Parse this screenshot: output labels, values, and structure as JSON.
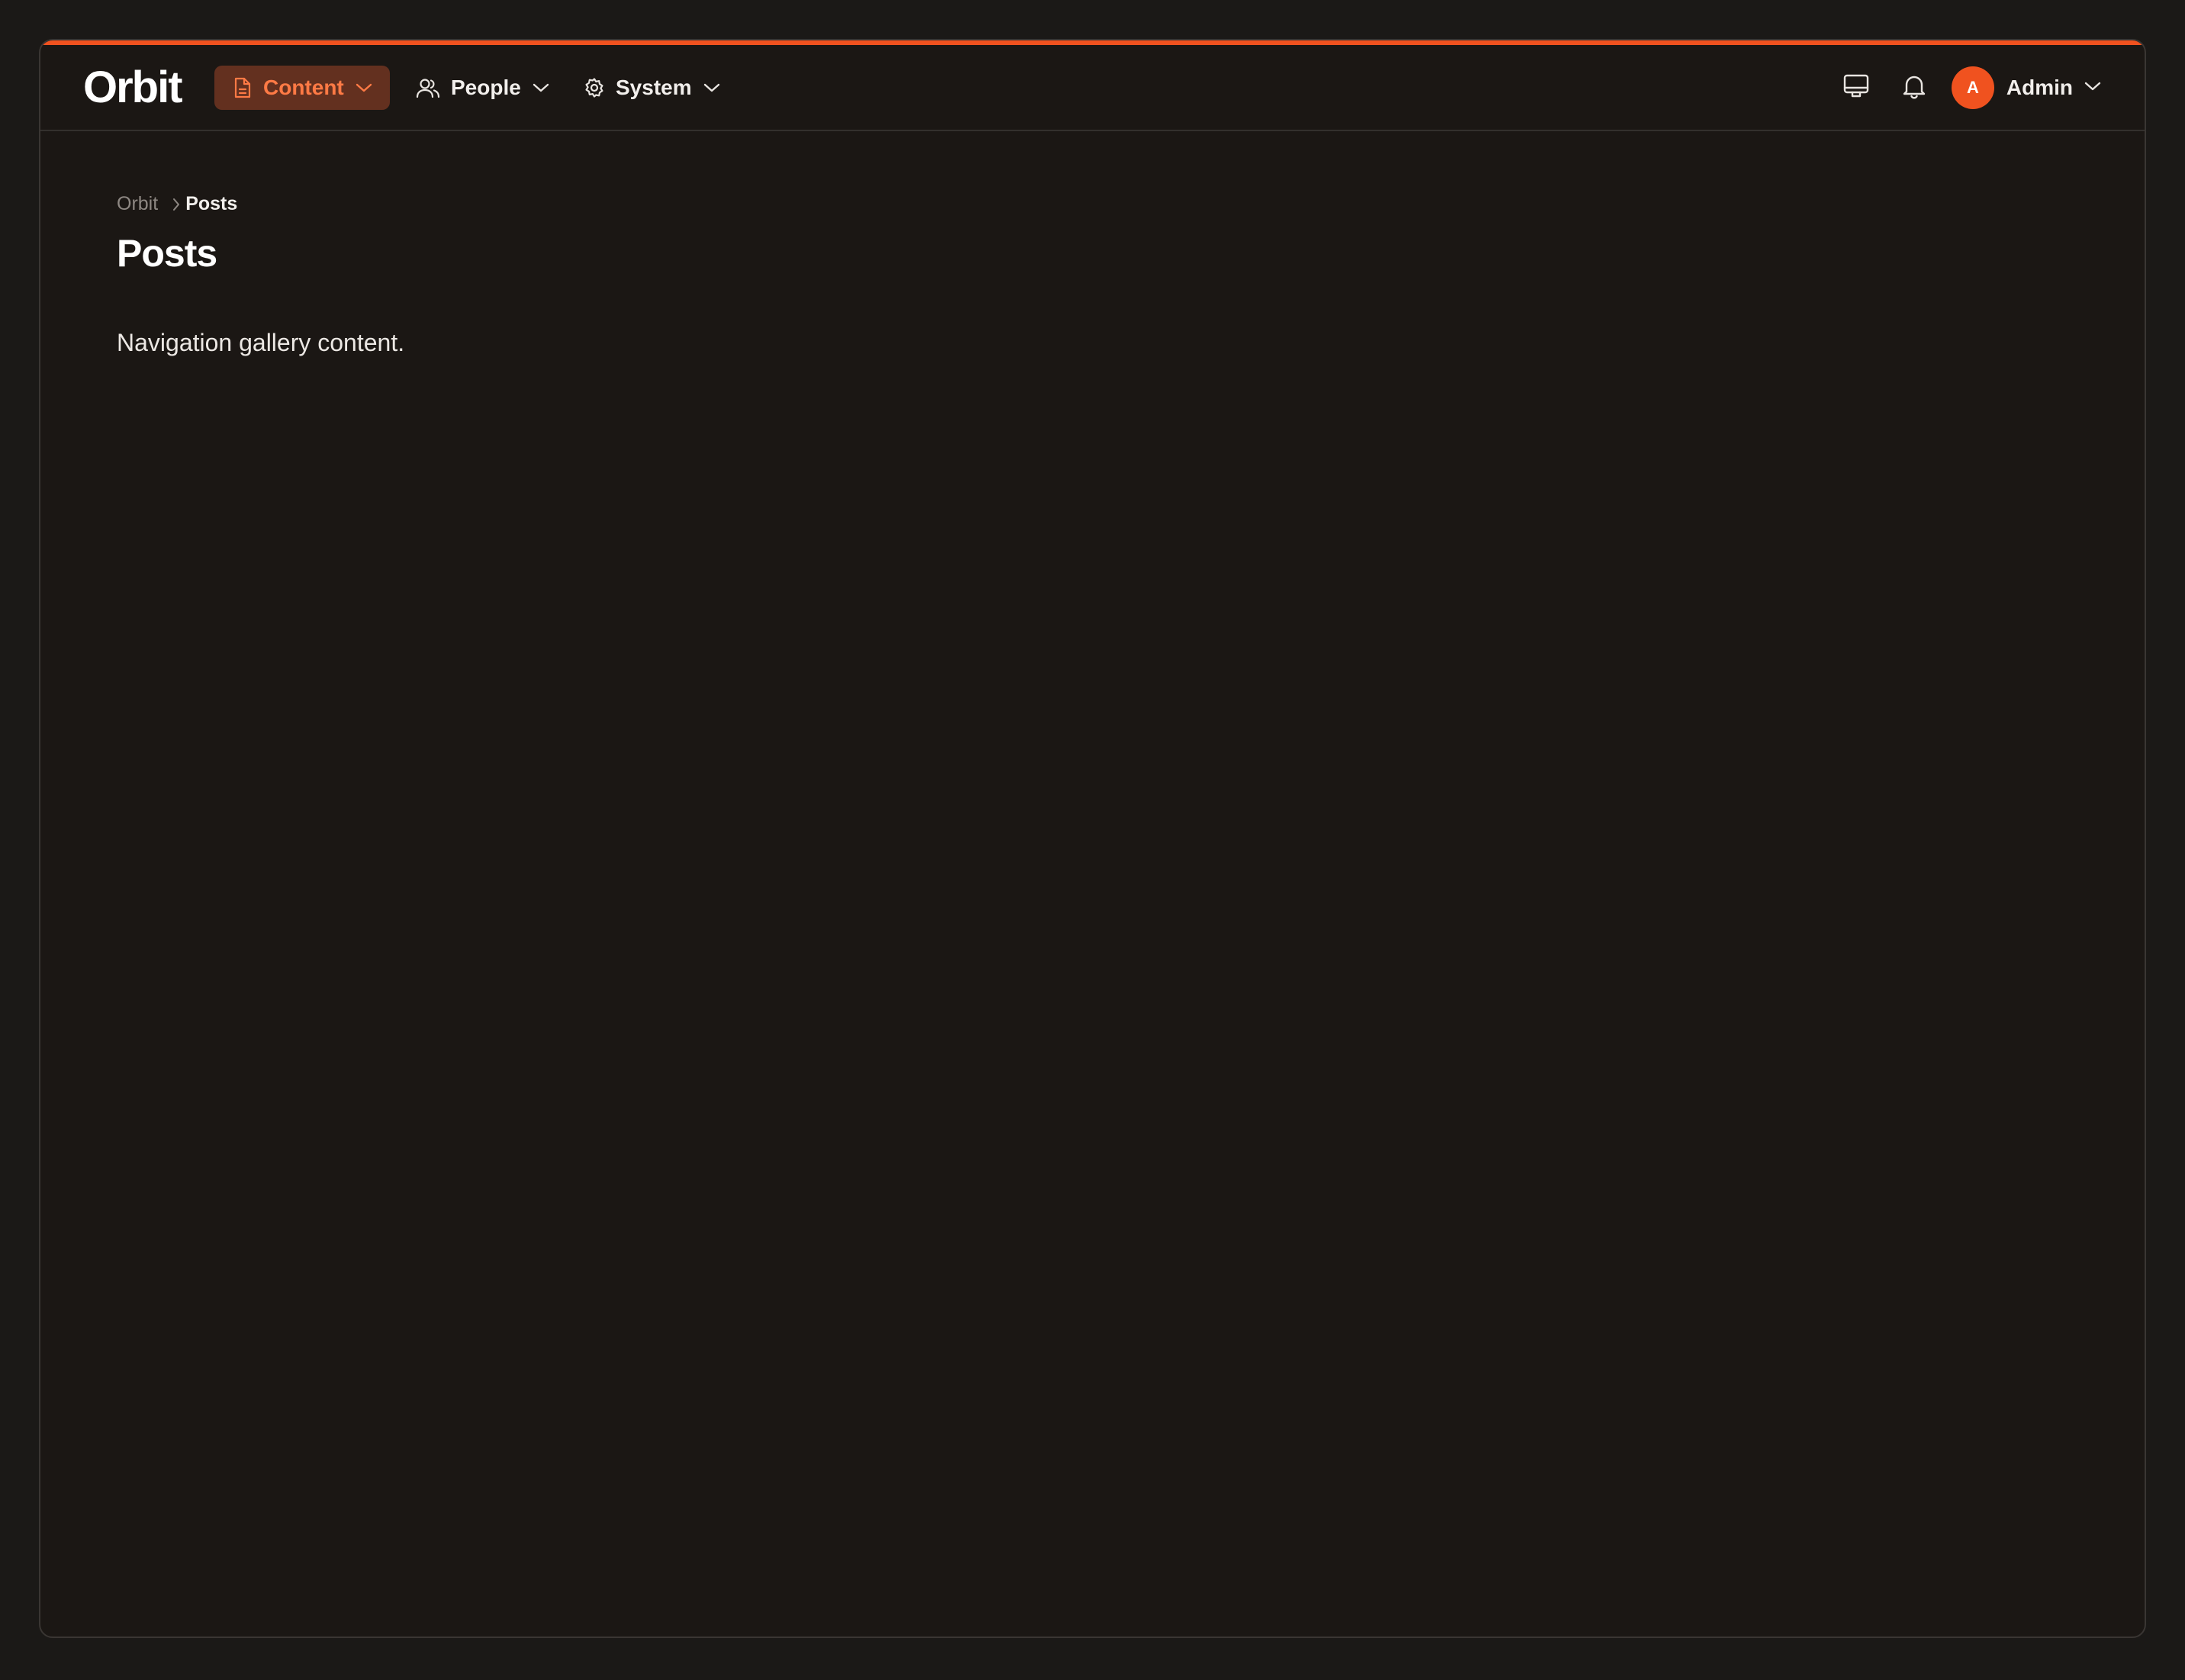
{
  "app": {
    "logo": "Orbit",
    "accent_color": "#f0521f"
  },
  "nav": {
    "items": [
      {
        "label": "Content",
        "icon": "document-icon",
        "active": true
      },
      {
        "label": "People",
        "icon": "users-icon",
        "active": false
      },
      {
        "label": "System",
        "icon": "gear-icon",
        "active": false
      }
    ]
  },
  "toolbar": {
    "display_icon": "monitor-icon",
    "notifications_icon": "bell-icon"
  },
  "user": {
    "avatar_initial": "A",
    "name": "Admin"
  },
  "breadcrumb": {
    "root": "Orbit",
    "current": "Posts"
  },
  "page": {
    "title": "Posts",
    "body": "Navigation gallery content."
  }
}
